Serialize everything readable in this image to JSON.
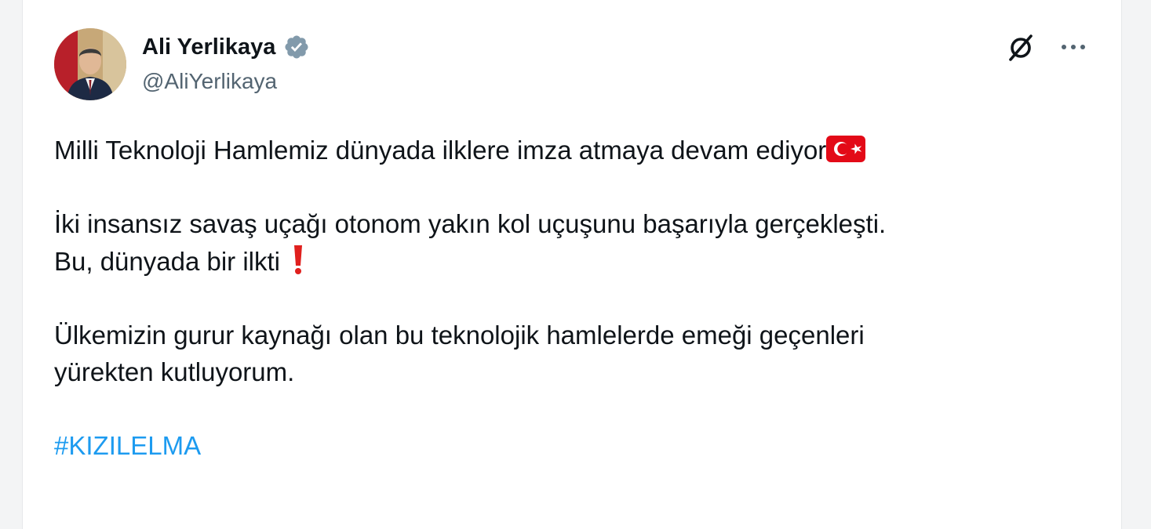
{
  "author": {
    "display_name": "Ali Yerlikaya",
    "handle": "@AliYerlikaya",
    "verified_badge": "verified-badge-icon",
    "avatar": "profile-photo"
  },
  "header_actions": {
    "grok_icon": "grok-icon",
    "more_icon": "more-options-icon"
  },
  "tweet": {
    "line1": "Milli Teknoloji Hamlemiz dünyada ilklere imza atmaya devam ediyor",
    "line1_emoji": "turkey-flag-icon",
    "line2": "İki insansız savaş uçağı otonom yakın kol uçuşunu başarıyla gerçekleşti.",
    "line3": "Bu, dünyada bir ilkti",
    "line3_emoji": "red-exclamation-icon",
    "line4": "Ülkemizin gurur kaynağı olan bu teknolojik hamlelerde emeği geçenleri",
    "line5": "yürekten kutluyorum.",
    "hashtag": "#KIZILELMA"
  },
  "colors": {
    "text": "#0f1419",
    "secondary_text": "#536471",
    "link": "#1d9bf0",
    "verified": "#829aab",
    "flag_red": "#e30a17"
  }
}
